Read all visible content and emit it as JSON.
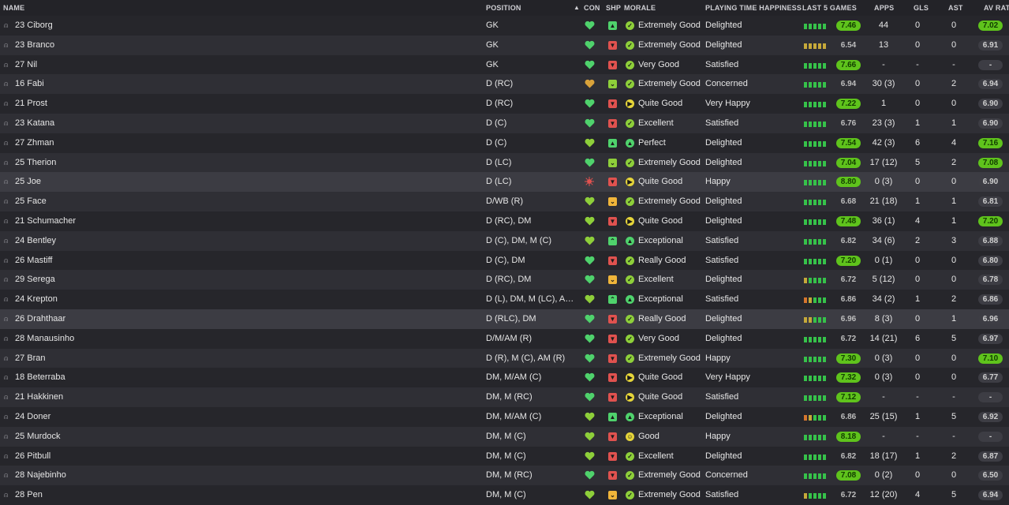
{
  "columns": {
    "name": "NAME",
    "position": "POSITION",
    "con": "CON",
    "shp": "SHP",
    "morale": "MORALE",
    "playing_time": "PLAYING TIME HAPPINESS",
    "last5": "LAST 5 GAMES",
    "apps": "APPS",
    "gls": "GLS",
    "ast": "AST",
    "av_rat": "AV RAT"
  },
  "sort": {
    "column": "position",
    "direction": "ascending",
    "icon": "sort-asc-icon"
  },
  "colors": {
    "good": "#4fd26c",
    "bad": "#e0524f",
    "warn": "#f0b53a",
    "rating_high": "#5fc31c",
    "morale_good": "#8ecf3a",
    "morale_ok": "#e6d53a"
  },
  "players": [
    {
      "name": "23 Ciborg",
      "position": "GK",
      "con": "heart",
      "shp": "up",
      "morale": "Extremely Good",
      "morale_icon": "tick",
      "pt": "Delighted",
      "last5": [
        "g",
        "g",
        "g",
        "g",
        "g"
      ],
      "rating": "7.46",
      "rating_hi": true,
      "apps": "44",
      "gls": "0",
      "ast": "0",
      "avr": "7.02",
      "avr_hi": true
    },
    {
      "name": "23 Branco",
      "position": "GK",
      "con": "heart",
      "shp": "down",
      "morale": "Extremely Good",
      "morale_icon": "tick",
      "pt": "Delighted",
      "last5": [
        "y",
        "y",
        "y",
        "y",
        "y"
      ],
      "rating": "6.54",
      "rating_hi": false,
      "apps": "13",
      "gls": "0",
      "ast": "0",
      "avr": "6.91",
      "avr_hi": false
    },
    {
      "name": "27 Nil",
      "position": "GK",
      "con": "heart",
      "shp": "down",
      "morale": "Very Good",
      "morale_icon": "tick",
      "pt": "Satisfied",
      "last5": [
        "g",
        "g",
        "g",
        "g",
        "g"
      ],
      "rating": "7.66",
      "rating_hi": true,
      "apps": "-",
      "gls": "-",
      "ast": "-",
      "avr": "-",
      "avr_hi": false
    },
    {
      "name": "16 Fabi",
      "position": "D (RC)",
      "con": "heart-warn",
      "shp": "ok",
      "morale": "Extremely Good",
      "morale_icon": "tick",
      "pt": "Concerned",
      "last5": [
        "g",
        "g",
        "g",
        "g",
        "g"
      ],
      "rating": "6.94",
      "rating_hi": false,
      "apps": "30 (3)",
      "gls": "0",
      "ast": "2",
      "avr": "6.94",
      "avr_hi": false
    },
    {
      "name": "21 Prost",
      "position": "D (RC)",
      "con": "heart",
      "shp": "down",
      "morale": "Quite Good",
      "morale_icon": "arrow",
      "pt": "Very Happy",
      "last5": [
        "g",
        "g",
        "g",
        "g",
        "g"
      ],
      "rating": "7.22",
      "rating_hi": true,
      "apps": "1",
      "gls": "0",
      "ast": "0",
      "avr": "6.90",
      "avr_hi": false
    },
    {
      "name": "23 Katana",
      "position": "D (C)",
      "con": "heart",
      "shp": "down",
      "morale": "Excellent",
      "morale_icon": "tick",
      "pt": "Satisfied",
      "last5": [
        "g",
        "g",
        "g",
        "g",
        "g"
      ],
      "rating": "6.76",
      "rating_hi": false,
      "apps": "23 (3)",
      "gls": "1",
      "ast": "1",
      "avr": "6.90",
      "avr_hi": false
    },
    {
      "name": "27 Zhman",
      "position": "D (C)",
      "con": "heart-ok",
      "shp": "up",
      "morale": "Perfect",
      "morale_icon": "up",
      "pt": "Delighted",
      "last5": [
        "g",
        "g",
        "g",
        "g",
        "g"
      ],
      "rating": "7.54",
      "rating_hi": true,
      "apps": "42 (3)",
      "gls": "6",
      "ast": "4",
      "avr": "7.16",
      "avr_hi": true
    },
    {
      "name": "25 Therion",
      "position": "D (LC)",
      "con": "heart",
      "shp": "ok",
      "morale": "Extremely Good",
      "morale_icon": "tick",
      "pt": "Delighted",
      "last5": [
        "g",
        "g",
        "g",
        "g",
        "g"
      ],
      "rating": "7.04",
      "rating_hi": true,
      "apps": "17 (12)",
      "gls": "5",
      "ast": "2",
      "avr": "7.08",
      "avr_hi": true
    },
    {
      "name": "25 Joe",
      "position": "D (LC)",
      "con": "injury",
      "shp": "down",
      "morale": "Quite Good",
      "morale_icon": "arrow",
      "pt": "Happy",
      "last5": [
        "g",
        "g",
        "g",
        "g",
        "g"
      ],
      "rating": "8.80",
      "rating_hi": true,
      "apps": "0 (3)",
      "gls": "0",
      "ast": "0",
      "avr": "6.90",
      "avr_hi": false
    },
    {
      "name": "25 Face",
      "position": "D/WB (R)",
      "con": "heart-ok",
      "shp": "warn",
      "morale": "Extremely Good",
      "morale_icon": "tick",
      "pt": "Delighted",
      "last5": [
        "g",
        "g",
        "g",
        "g",
        "g"
      ],
      "rating": "6.68",
      "rating_hi": false,
      "apps": "21 (18)",
      "gls": "1",
      "ast": "1",
      "avr": "6.81",
      "avr_hi": false
    },
    {
      "name": "21 Schumacher",
      "position": "D (RC), DM",
      "con": "heart-ok",
      "shp": "down",
      "morale": "Quite Good",
      "morale_icon": "arrow",
      "pt": "Delighted",
      "last5": [
        "g",
        "g",
        "g",
        "g",
        "g"
      ],
      "rating": "7.48",
      "rating_hi": true,
      "apps": "36 (1)",
      "gls": "4",
      "ast": "1",
      "avr": "7.20",
      "avr_hi": true
    },
    {
      "name": "24 Bentley",
      "position": "D (C), DM, M (C)",
      "con": "heart-ok",
      "shp": "upup",
      "morale": "Exceptional",
      "morale_icon": "up",
      "pt": "Satisfied",
      "last5": [
        "g",
        "g",
        "g",
        "g",
        "g"
      ],
      "rating": "6.82",
      "rating_hi": false,
      "apps": "34 (6)",
      "gls": "2",
      "ast": "3",
      "avr": "6.88",
      "avr_hi": false
    },
    {
      "name": "26 Mastiff",
      "position": "D (C), DM",
      "con": "heart",
      "shp": "down",
      "morale": "Really Good",
      "morale_icon": "tick",
      "pt": "Satisfied",
      "last5": [
        "g",
        "g",
        "g",
        "g",
        "g"
      ],
      "rating": "7.20",
      "rating_hi": true,
      "apps": "0 (1)",
      "gls": "0",
      "ast": "0",
      "avr": "6.80",
      "avr_hi": false
    },
    {
      "name": "29 Serega",
      "position": "D (RC), DM",
      "con": "heart",
      "shp": "warn",
      "morale": "Excellent",
      "morale_icon": "tick",
      "pt": "Delighted",
      "last5": [
        "y",
        "g",
        "g",
        "g",
        "g"
      ],
      "rating": "6.72",
      "rating_hi": false,
      "apps": "5 (12)",
      "gls": "0",
      "ast": "0",
      "avr": "6.78",
      "avr_hi": false
    },
    {
      "name": "24 Krepton",
      "position": "D (L), DM, M (LC), AM (...",
      "con": "heart-ok",
      "shp": "upup",
      "morale": "Exceptional",
      "morale_icon": "up",
      "pt": "Satisfied",
      "last5": [
        "o",
        "y",
        "g",
        "g",
        "g"
      ],
      "rating": "6.86",
      "rating_hi": false,
      "apps": "34 (2)",
      "gls": "1",
      "ast": "2",
      "avr": "6.86",
      "avr_hi": false
    },
    {
      "name": "26 Drahthaar",
      "position": "D (RLC), DM",
      "con": "heart",
      "shp": "down",
      "morale": "Really Good",
      "morale_icon": "tick",
      "pt": "Delighted",
      "last5": [
        "y",
        "y",
        "g",
        "g",
        "g"
      ],
      "rating": "6.96",
      "rating_hi": false,
      "apps": "8 (3)",
      "gls": "0",
      "ast": "1",
      "avr": "6.96",
      "avr_hi": false
    },
    {
      "name": "28 Manausinho",
      "position": "D/M/AM (R)",
      "con": "heart",
      "shp": "down",
      "morale": "Very Good",
      "morale_icon": "tick",
      "pt": "Delighted",
      "last5": [
        "g",
        "g",
        "g",
        "g",
        "g"
      ],
      "rating": "6.72",
      "rating_hi": false,
      "apps": "14 (21)",
      "gls": "6",
      "ast": "5",
      "avr": "6.97",
      "avr_hi": false
    },
    {
      "name": "27 Bran",
      "position": "D (R), M (C), AM (R)",
      "con": "heart",
      "shp": "down",
      "morale": "Extremely Good",
      "morale_icon": "tick",
      "pt": "Happy",
      "last5": [
        "g",
        "g",
        "g",
        "g",
        "g"
      ],
      "rating": "7.30",
      "rating_hi": true,
      "apps": "0 (3)",
      "gls": "0",
      "ast": "0",
      "avr": "7.10",
      "avr_hi": true
    },
    {
      "name": "18 Beterraba",
      "position": "DM, M/AM (C)",
      "con": "heart",
      "shp": "down",
      "morale": "Quite Good",
      "morale_icon": "arrow",
      "pt": "Very Happy",
      "last5": [
        "g",
        "g",
        "g",
        "g",
        "g"
      ],
      "rating": "7.32",
      "rating_hi": true,
      "apps": "0 (3)",
      "gls": "0",
      "ast": "0",
      "avr": "6.77",
      "avr_hi": false
    },
    {
      "name": "21 Hakkinen",
      "position": "DM, M (RC)",
      "con": "heart",
      "shp": "down",
      "morale": "Quite Good",
      "morale_icon": "arrow",
      "pt": "Satisfied",
      "last5": [
        "g",
        "g",
        "g",
        "g",
        "g"
      ],
      "rating": "7.12",
      "rating_hi": true,
      "apps": "-",
      "gls": "-",
      "ast": "-",
      "avr": "-",
      "avr_hi": false
    },
    {
      "name": "24 Doner",
      "position": "DM, M/AM (C)",
      "con": "heart-ok",
      "shp": "up",
      "morale": "Exceptional",
      "morale_icon": "up",
      "pt": "Delighted",
      "last5": [
        "o",
        "y",
        "g",
        "g",
        "g"
      ],
      "rating": "6.86",
      "rating_hi": false,
      "apps": "25 (15)",
      "gls": "1",
      "ast": "5",
      "avr": "6.92",
      "avr_hi": false
    },
    {
      "name": "25 Murdock",
      "position": "DM, M (C)",
      "con": "heart-ok",
      "shp": "down",
      "morale": "Good",
      "morale_icon": "smile",
      "pt": "Happy",
      "last5": [
        "g",
        "g",
        "g",
        "g",
        "g"
      ],
      "rating": "8.18",
      "rating_hi": true,
      "apps": "-",
      "gls": "-",
      "ast": "-",
      "avr": "-",
      "avr_hi": false
    },
    {
      "name": "26 Pitbull",
      "position": "DM, M (C)",
      "con": "heart-ok",
      "shp": "down",
      "morale": "Excellent",
      "morale_icon": "tick",
      "pt": "Delighted",
      "last5": [
        "g",
        "g",
        "g",
        "g",
        "g"
      ],
      "rating": "6.82",
      "rating_hi": false,
      "apps": "18 (17)",
      "gls": "1",
      "ast": "2",
      "avr": "6.87",
      "avr_hi": false
    },
    {
      "name": "28 Najebinho",
      "position": "DM, M (RC)",
      "con": "heart",
      "shp": "down",
      "morale": "Extremely Good",
      "morale_icon": "tick",
      "pt": "Concerned",
      "last5": [
        "g",
        "g",
        "g",
        "g",
        "g"
      ],
      "rating": "7.08",
      "rating_hi": true,
      "apps": "0 (2)",
      "gls": "0",
      "ast": "0",
      "avr": "6.50",
      "avr_hi": false
    },
    {
      "name": "28 Pen",
      "position": "DM, M (C)",
      "con": "heart-ok",
      "shp": "warn",
      "morale": "Extremely Good",
      "morale_icon": "tick",
      "pt": "Satisfied",
      "last5": [
        "y",
        "g",
        "g",
        "g",
        "g"
      ],
      "rating": "6.72",
      "rating_hi": false,
      "apps": "12 (20)",
      "gls": "4",
      "ast": "5",
      "avr": "6.94",
      "avr_hi": false
    }
  ]
}
